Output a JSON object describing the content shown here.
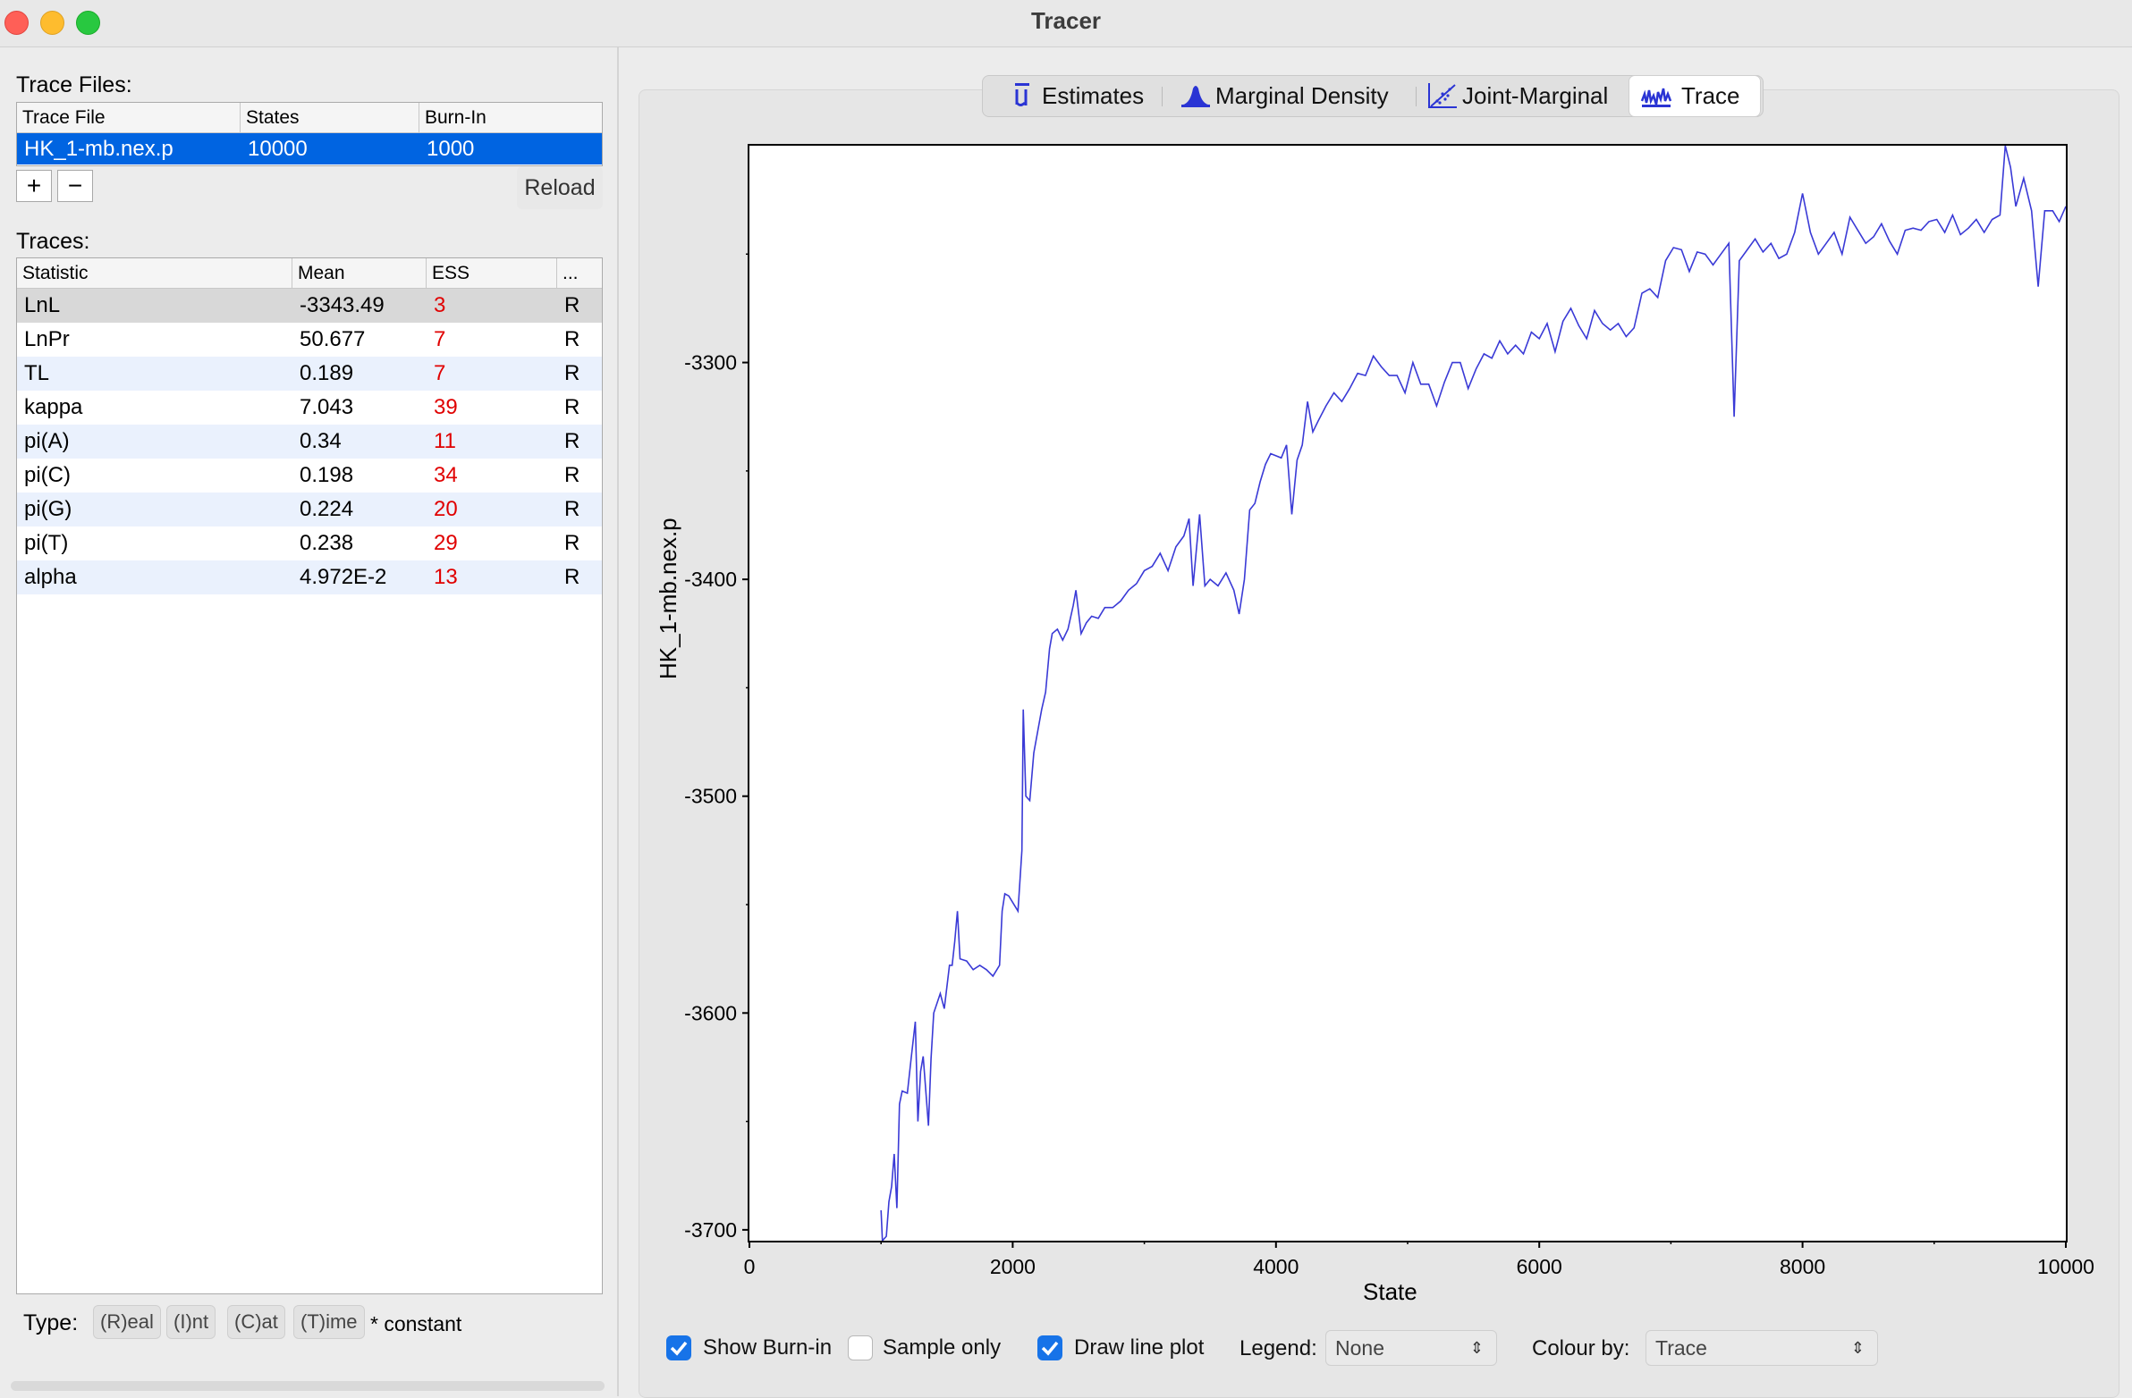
{
  "window": {
    "title": "Tracer"
  },
  "left": {
    "trace_files_label": "Trace Files:",
    "trace_files_table": {
      "headers": [
        "Trace File",
        "States",
        "Burn-In"
      ],
      "rows": [
        {
          "file": "HK_1-mb.nex.p",
          "states": "10000",
          "burnin": "1000"
        }
      ]
    },
    "add_label": "+",
    "remove_label": "−",
    "reload_label": "Reload",
    "traces_label": "Traces:",
    "traces_table": {
      "headers": [
        "Statistic",
        "Mean",
        "ESS",
        "..."
      ],
      "rows": [
        {
          "stat": "LnL",
          "mean": "-3343.49",
          "ess": "3",
          "type": "R"
        },
        {
          "stat": "LnPr",
          "mean": "50.677",
          "ess": "7",
          "type": "R"
        },
        {
          "stat": "TL",
          "mean": "0.189",
          "ess": "7",
          "type": "R"
        },
        {
          "stat": "kappa",
          "mean": "7.043",
          "ess": "39",
          "type": "R"
        },
        {
          "stat": "pi(A)",
          "mean": "0.34",
          "ess": "11",
          "type": "R"
        },
        {
          "stat": "pi(C)",
          "mean": "0.198",
          "ess": "34",
          "type": "R"
        },
        {
          "stat": "pi(G)",
          "mean": "0.224",
          "ess": "20",
          "type": "R"
        },
        {
          "stat": "pi(T)",
          "mean": "0.238",
          "ess": "29",
          "type": "R"
        },
        {
          "stat": "alpha",
          "mean": "4.972E-2",
          "ess": "13",
          "type": "R"
        }
      ]
    },
    "type_label": "Type:",
    "type_tags": [
      "(R)eal",
      "(I)nt",
      "(C)at",
      "(T)ime"
    ],
    "constant_note": "* constant"
  },
  "tabs": [
    {
      "label": "Estimates",
      "icon": "mu-bar-icon",
      "active": false
    },
    {
      "label": "Marginal Density",
      "icon": "density-peak-icon",
      "active": false
    },
    {
      "label": "Joint-Marginal",
      "icon": "scatter-line-icon",
      "active": false
    },
    {
      "label": "Trace",
      "icon": "trace-wave-icon",
      "active": true
    }
  ],
  "chart_data": {
    "type": "line",
    "title": "",
    "xlabel": "State",
    "ylabel": "HK_1-mb.nex.p",
    "xlim": [
      0,
      10000
    ],
    "ylim": [
      -3705,
      -3200
    ],
    "x_ticks": [
      0,
      2000,
      4000,
      6000,
      8000,
      10000
    ],
    "y_ticks": [
      -3300,
      -3400,
      -3500,
      -3600,
      -3700
    ],
    "series": [
      {
        "color": "#3a3ad6",
        "points": [
          [
            1000,
            -3691
          ],
          [
            1010,
            -3705
          ],
          [
            1040,
            -3703
          ],
          [
            1060,
            -3687
          ],
          [
            1080,
            -3680
          ],
          [
            1100,
            -3665
          ],
          [
            1120,
            -3690
          ],
          [
            1140,
            -3642
          ],
          [
            1160,
            -3636
          ],
          [
            1200,
            -3637
          ],
          [
            1230,
            -3620
          ],
          [
            1260,
            -3604
          ],
          [
            1280,
            -3650
          ],
          [
            1300,
            -3627
          ],
          [
            1320,
            -3620
          ],
          [
            1360,
            -3652
          ],
          [
            1380,
            -3621
          ],
          [
            1400,
            -3600
          ],
          [
            1450,
            -3591
          ],
          [
            1480,
            -3598
          ],
          [
            1520,
            -3578
          ],
          [
            1540,
            -3578
          ],
          [
            1560,
            -3567
          ],
          [
            1580,
            -3553
          ],
          [
            1600,
            -3575
          ],
          [
            1650,
            -3576
          ],
          [
            1700,
            -3580
          ],
          [
            1750,
            -3578
          ],
          [
            1800,
            -3580
          ],
          [
            1850,
            -3583
          ],
          [
            1900,
            -3578
          ],
          [
            1920,
            -3553
          ],
          [
            1940,
            -3545
          ],
          [
            1970,
            -3546
          ],
          [
            2000,
            -3549
          ],
          [
            2040,
            -3553
          ],
          [
            2070,
            -3525
          ],
          [
            2080,
            -3460
          ],
          [
            2100,
            -3500
          ],
          [
            2130,
            -3502
          ],
          [
            2160,
            -3480
          ],
          [
            2190,
            -3470
          ],
          [
            2220,
            -3460
          ],
          [
            2250,
            -3452
          ],
          [
            2280,
            -3432
          ],
          [
            2300,
            -3425
          ],
          [
            2340,
            -3423
          ],
          [
            2380,
            -3428
          ],
          [
            2420,
            -3423
          ],
          [
            2460,
            -3412
          ],
          [
            2480,
            -3405
          ],
          [
            2520,
            -3425
          ],
          [
            2560,
            -3420
          ],
          [
            2600,
            -3417
          ],
          [
            2650,
            -3418
          ],
          [
            2700,
            -3413
          ],
          [
            2760,
            -3413
          ],
          [
            2820,
            -3410
          ],
          [
            2880,
            -3405
          ],
          [
            2940,
            -3402
          ],
          [
            3000,
            -3396
          ],
          [
            3060,
            -3394
          ],
          [
            3120,
            -3388
          ],
          [
            3180,
            -3396
          ],
          [
            3240,
            -3385
          ],
          [
            3300,
            -3380
          ],
          [
            3340,
            -3372
          ],
          [
            3370,
            -3403
          ],
          [
            3420,
            -3370
          ],
          [
            3460,
            -3403
          ],
          [
            3500,
            -3400
          ],
          [
            3560,
            -3403
          ],
          [
            3620,
            -3397
          ],
          [
            3680,
            -3405
          ],
          [
            3720,
            -3416
          ],
          [
            3760,
            -3400
          ],
          [
            3800,
            -3368
          ],
          [
            3840,
            -3365
          ],
          [
            3880,
            -3355
          ],
          [
            3920,
            -3347
          ],
          [
            3960,
            -3342
          ],
          [
            4000,
            -3343
          ],
          [
            4040,
            -3344
          ],
          [
            4080,
            -3338
          ],
          [
            4120,
            -3370
          ],
          [
            4160,
            -3345
          ],
          [
            4200,
            -3338
          ],
          [
            4240,
            -3318
          ],
          [
            4280,
            -3332
          ],
          [
            4320,
            -3327
          ],
          [
            4380,
            -3320
          ],
          [
            4440,
            -3314
          ],
          [
            4500,
            -3318
          ],
          [
            4560,
            -3312
          ],
          [
            4620,
            -3305
          ],
          [
            4680,
            -3306
          ],
          [
            4740,
            -3297
          ],
          [
            4800,
            -3302
          ],
          [
            4860,
            -3306
          ],
          [
            4920,
            -3306
          ],
          [
            4980,
            -3314
          ],
          [
            5040,
            -3300
          ],
          [
            5100,
            -3310
          ],
          [
            5160,
            -3310
          ],
          [
            5220,
            -3320
          ],
          [
            5280,
            -3309
          ],
          [
            5340,
            -3300
          ],
          [
            5400,
            -3300
          ],
          [
            5460,
            -3312
          ],
          [
            5520,
            -3303
          ],
          [
            5580,
            -3296
          ],
          [
            5640,
            -3298
          ],
          [
            5700,
            -3290
          ],
          [
            5760,
            -3296
          ],
          [
            5820,
            -3292
          ],
          [
            5880,
            -3296
          ],
          [
            5940,
            -3286
          ],
          [
            6000,
            -3289
          ],
          [
            6060,
            -3282
          ],
          [
            6120,
            -3295
          ],
          [
            6180,
            -3281
          ],
          [
            6240,
            -3275
          ],
          [
            6300,
            -3283
          ],
          [
            6360,
            -3289
          ],
          [
            6420,
            -3276
          ],
          [
            6480,
            -3282
          ],
          [
            6540,
            -3285
          ],
          [
            6600,
            -3282
          ],
          [
            6660,
            -3288
          ],
          [
            6720,
            -3284
          ],
          [
            6780,
            -3268
          ],
          [
            6840,
            -3266
          ],
          [
            6900,
            -3270
          ],
          [
            6960,
            -3253
          ],
          [
            7020,
            -3247
          ],
          [
            7080,
            -3248
          ],
          [
            7140,
            -3258
          ],
          [
            7200,
            -3249
          ],
          [
            7260,
            -3250
          ],
          [
            7320,
            -3255
          ],
          [
            7380,
            -3250
          ],
          [
            7440,
            -3245
          ],
          [
            7480,
            -3325
          ],
          [
            7520,
            -3253
          ],
          [
            7580,
            -3248
          ],
          [
            7640,
            -3243
          ],
          [
            7700,
            -3249
          ],
          [
            7760,
            -3245
          ],
          [
            7820,
            -3252
          ],
          [
            7880,
            -3250
          ],
          [
            7940,
            -3240
          ],
          [
            8000,
            -3222
          ],
          [
            8060,
            -3240
          ],
          [
            8120,
            -3250
          ],
          [
            8180,
            -3245
          ],
          [
            8240,
            -3240
          ],
          [
            8300,
            -3250
          ],
          [
            8360,
            -3233
          ],
          [
            8420,
            -3239
          ],
          [
            8480,
            -3245
          ],
          [
            8540,
            -3242
          ],
          [
            8600,
            -3236
          ],
          [
            8660,
            -3244
          ],
          [
            8720,
            -3250
          ],
          [
            8780,
            -3239
          ],
          [
            8840,
            -3238
          ],
          [
            8900,
            -3239
          ],
          [
            8960,
            -3235
          ],
          [
            9020,
            -3234
          ],
          [
            9080,
            -3240
          ],
          [
            9140,
            -3232
          ],
          [
            9200,
            -3241
          ],
          [
            9260,
            -3238
          ],
          [
            9320,
            -3234
          ],
          [
            9380,
            -3240
          ],
          [
            9440,
            -3234
          ],
          [
            9500,
            -3232
          ],
          [
            9540,
            -3200
          ],
          [
            9580,
            -3210
          ],
          [
            9620,
            -3228
          ],
          [
            9680,
            -3215
          ],
          [
            9740,
            -3230
          ],
          [
            9790,
            -3265
          ],
          [
            9840,
            -3230
          ],
          [
            9900,
            -3230
          ],
          [
            9950,
            -3235
          ],
          [
            10000,
            -3228
          ]
        ]
      }
    ],
    "burnin_line_x": 1000
  },
  "controls": {
    "show_burnin_label": "Show Burn-in",
    "show_burnin_checked": true,
    "sample_only_label": "Sample only",
    "sample_only_checked": false,
    "draw_line_label": "Draw line plot",
    "draw_line_checked": true,
    "legend_label": "Legend:",
    "legend_value": "None",
    "colour_label": "Colour by:",
    "colour_value": "Trace"
  }
}
